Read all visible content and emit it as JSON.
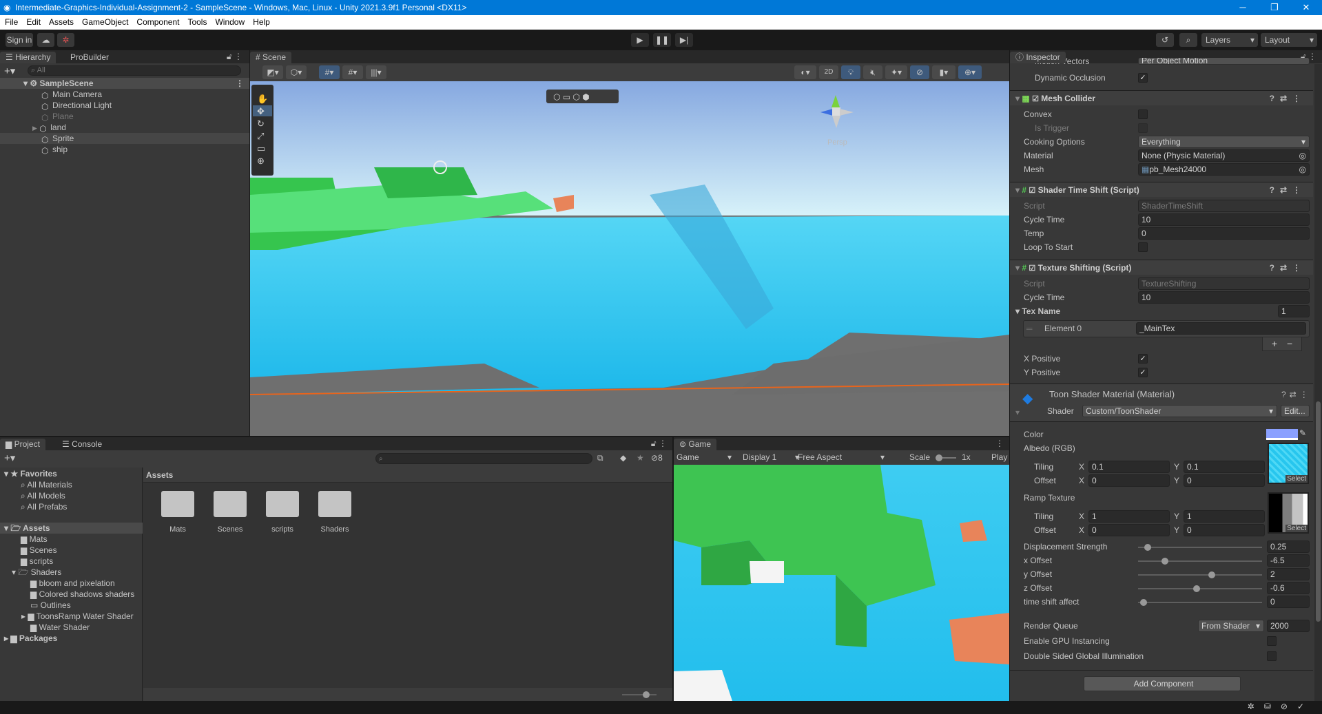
{
  "window": {
    "title": "Intermediate-Graphics-Individual-Assignment-2 - SampleScene - Windows, Mac, Linux - Unity 2021.3.9f1 Personal <DX11>",
    "minimize": "─",
    "maximize": "❐",
    "close": "✕"
  },
  "menu": [
    "File",
    "Edit",
    "Assets",
    "GameObject",
    "Component",
    "Tools",
    "Window",
    "Help"
  ],
  "toolbar": {
    "sign_in": "Sign in",
    "layers": "Layers",
    "layout": "Layout"
  },
  "hierarchy": {
    "tab": "Hierarchy",
    "tab2": "ProBuilder",
    "search_placeholder": "All",
    "scene": "SampleScene",
    "items": [
      "Main Camera",
      "Directional Light",
      "Plane",
      "land",
      "Sprite",
      "ship"
    ]
  },
  "scene": {
    "tab": "Scene",
    "btn_2d": "2D",
    "persp": "Persp"
  },
  "project": {
    "tab": "Project",
    "tab2": "Console",
    "hidden_count": "8",
    "favorites": "Favorites",
    "fav_items": [
      "All Materials",
      "All Models",
      "All Prefabs"
    ],
    "assets": "Assets",
    "asset_folders": [
      "Mats",
      "Scenes",
      "scripts",
      "Shaders"
    ],
    "shader_folders": [
      "bloom and pixelation",
      "Colored shadows shaders",
      "Outlines",
      "ToonsRamp Water Shader",
      "Water Shader"
    ],
    "packages": "Packages",
    "breadcrumb": "Assets",
    "grid_items": [
      "Mats",
      "Scenes",
      "scripts",
      "Shaders"
    ]
  },
  "game": {
    "tab": "Game",
    "mode": "Game",
    "display": "Display 1",
    "aspect": "Free Aspect",
    "scale_label": "Scale",
    "scale_value": "1x",
    "play": "Play"
  },
  "inspector": {
    "tab": "Inspector",
    "motion_vectors": {
      "label": "Motion Vectors",
      "value": "Per Object Motion"
    },
    "dynamic_occlusion": {
      "label": "Dynamic Occlusion",
      "checked": true
    },
    "mesh_collider": {
      "title": "Mesh Collider",
      "convex": "Convex",
      "is_trigger": "Is Trigger",
      "cooking_label": "Cooking Options",
      "cooking_value": "Everything",
      "material_label": "Material",
      "material_value": "None (Physic Material)",
      "mesh_label": "Mesh",
      "mesh_value": "pb_Mesh24000"
    },
    "shader_time_shift": {
      "title": "Shader Time Shift (Script)",
      "script_label": "Script",
      "script_value": "ShaderTimeShift",
      "cycle_label": "Cycle Time",
      "cycle_value": "10",
      "temp_label": "Temp",
      "temp_value": "0",
      "loop_label": "Loop To Start"
    },
    "texture_shifting": {
      "title": "Texture Shifting (Script)",
      "script_label": "Script",
      "script_value": "TextureShifting",
      "cycle_label": "Cycle Time",
      "cycle_value": "10",
      "tex_name_label": "Tex Name",
      "tex_name_count": "1",
      "element_label": "Element 0",
      "element_value": "_MainTex",
      "add": "+",
      "remove": "−",
      "x_positive": "X Positive",
      "y_positive": "Y Positive"
    },
    "material": {
      "title": "Toon Shader Material (Material)",
      "shader_label": "Shader",
      "shader_value": "Custom/ToonShader",
      "edit": "Edit...",
      "color_label": "Color",
      "color_value": "#8aa0ff",
      "albedo_label": "Albedo (RGB)",
      "tiling": "Tiling",
      "offset": "Offset",
      "x": "X",
      "y": "Y",
      "albedo_tiling_x": "0.1",
      "albedo_tiling_y": "0.1",
      "albedo_offset_x": "0",
      "albedo_offset_y": "0",
      "ramp_label": "Ramp Texture",
      "ramp_tiling_x": "1",
      "ramp_tiling_y": "1",
      "ramp_offset_x": "0",
      "ramp_offset_y": "0",
      "select": "Select",
      "sliders": [
        {
          "label": "Displacement Strength",
          "value": "0.25",
          "fraction": 0.05
        },
        {
          "label": "x Offset",
          "value": "-6.5",
          "fraction": 0.2
        },
        {
          "label": "y Offset",
          "value": "2",
          "fraction": 0.6
        },
        {
          "label": "z Offset",
          "value": "-0.6",
          "fraction": 0.47
        },
        {
          "label": "time shift affect",
          "value": "0",
          "fraction": 0.02
        }
      ],
      "render_queue_label": "Render Queue",
      "render_queue_mode": "From Shader",
      "render_queue_value": "2000",
      "gpu_instancing": "Enable GPU Instancing",
      "double_sided": "Double Sided Global Illumination"
    },
    "add_component": "Add Component"
  }
}
